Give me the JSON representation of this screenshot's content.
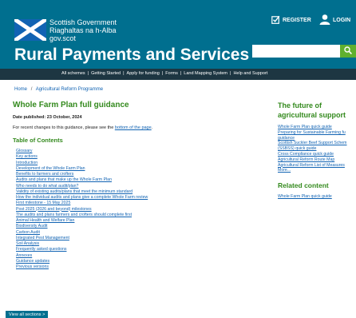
{
  "header": {
    "logo_lines": [
      "Scottish Government",
      "Riaghaltas na h-Alba",
      "gov.scot"
    ],
    "register_label": "REGISTER",
    "login_label": "LOGIN",
    "site_title": "Rural Payments and Services",
    "search_placeholder": "",
    "register_icon": "check-box-icon",
    "login_icon": "user-icon",
    "search_icon": "search-icon"
  },
  "nav": {
    "items": [
      "All schemes",
      "Getting Started",
      "Apply for funding",
      "Forms",
      "Land Mapping System",
      "Help and Support"
    ]
  },
  "breadcrumb": [
    "Home",
    "Agricultural Reform Programme"
  ],
  "main": {
    "title": "Whole Farm Plan full guidance",
    "published": "Date published: 23 October, 2024",
    "recent_prefix": "For recent changes to this guidance, please see the ",
    "recent_link": "bottom of the page",
    "recent_suffix": ".",
    "toc_heading": "Table of Contents",
    "toc": [
      "Glossary",
      "Key actions",
      "Introduction",
      "Development of the Whole Farm Plan",
      "Benefits to farmers and crofters",
      "Audits and plans that make up the Whole Farm Plan",
      "Who needs to do what audit/plan?",
      "Validity of existing audits/plans that meet the minimum standard",
      "How the individual audits and plans give a complete Whole Farm review",
      "First milestone - 15 May 2025",
      "Post 2025 (2026 and beyond) milestones",
      "The audits and plans farmers and crofters should complete first",
      "Animal Health and Welfare Plan",
      "Biodiversity Audit",
      "Carbon Audit",
      "Integrated Pest Management",
      "Soil Analysis",
      "Frequently asked questions",
      "Annexes",
      "Guidance updates",
      "Previous versions"
    ],
    "view_all": "View all sections >"
  },
  "sidebar": {
    "heading_lines": [
      "The future of",
      "agricultural support"
    ],
    "links": [
      "Whole Farm Plan quick guide",
      "Preparing for Sustainable Farming fu",
      "guidance",
      "Scottish Suckler Beef Support Schem",
      "(SSBSS) quick guide",
      "Cross Compliance quick guide",
      "Agricultural Reform Route Map",
      "Agricultural Reform List of Measures",
      "More..."
    ],
    "related_heading": "Related content",
    "related_links": [
      "Whole Farm Plan quick guide"
    ]
  },
  "colors": {
    "header_bg": "#006f8f",
    "nav_bg": "#1d3642",
    "title_green": "#348a1e",
    "link_blue": "#1163b3",
    "search_btn": "#60b02f",
    "logo_blue": "#1163b3"
  }
}
